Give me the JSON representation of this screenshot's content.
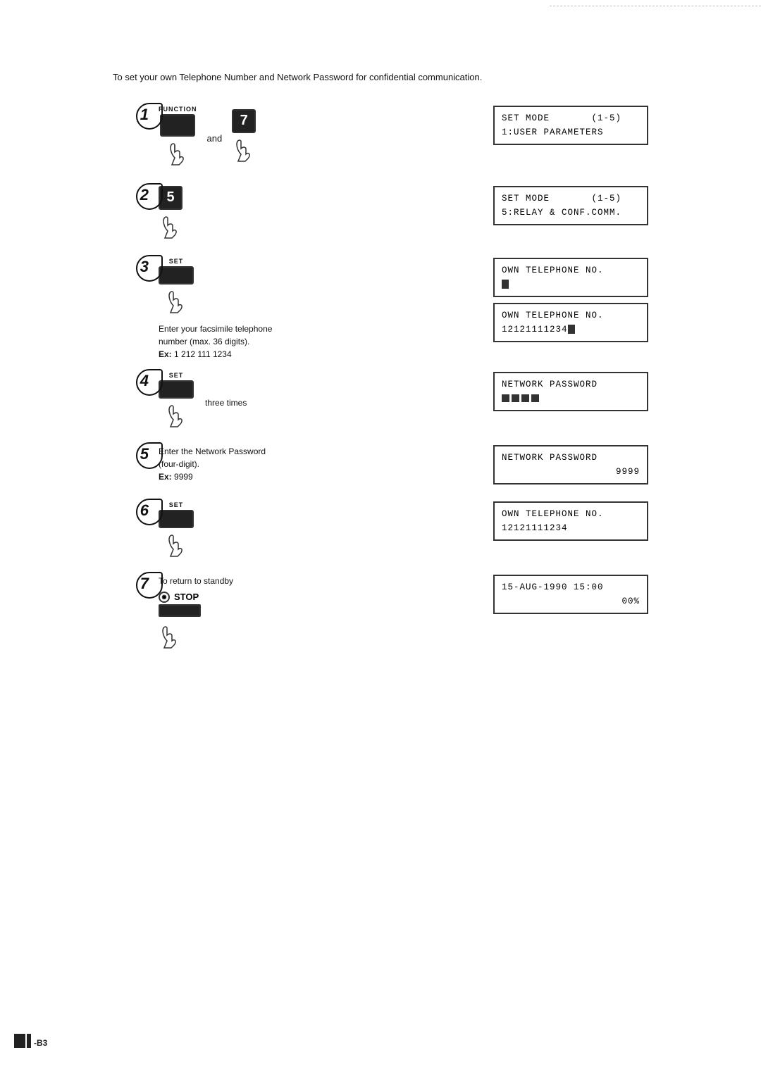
{
  "intro": {
    "text": "To set your own Telephone Number and Network Password for confidential communication."
  },
  "steps": [
    {
      "number": "1",
      "action_label": "FUNCTION + 7",
      "and_text": "and",
      "display": {
        "line1": "SET  MODE        (1-5)",
        "line2": "1:USER  PARAMETERS"
      }
    },
    {
      "number": "2",
      "action_label": "5",
      "display": {
        "line1": "SET  MODE        (1-5)",
        "line2": "5:RELAY & CONF.COMM."
      }
    },
    {
      "number": "3",
      "action_label": "SET",
      "description_line1": "Enter your facsimile telephone",
      "description_line2": "number (max. 36 digits).",
      "example": "Ex:  1 212 111 1234",
      "display1": {
        "line1": "OWN  TELEPHONE  NO.",
        "line2": "■"
      },
      "display2": {
        "line1": "OWN  TELEPHONE  NO.",
        "line2": "12121111234■"
      }
    },
    {
      "number": "4",
      "action_label": "SET",
      "three_times": "three times",
      "display": {
        "line1": "NETWORK  PASSWORD",
        "line2": "████"
      }
    },
    {
      "number": "5",
      "description_line1": "Enter the Network Password",
      "description_line2": "(four-digit).",
      "example": "Ex:  9999",
      "display": {
        "line1": "NETWORK  PASSWORD",
        "line2": "                9999"
      }
    },
    {
      "number": "6",
      "action_label": "SET",
      "display": {
        "line1": "OWN  TELEPHONE  NO.",
        "line2": "12121111234"
      }
    },
    {
      "number": "7",
      "description": "To return to standby",
      "stop_label": "STOP",
      "display": {
        "line1": "15-AUG-1990  15:00",
        "line2": "                 00%"
      }
    }
  ],
  "footer": {
    "page_num": "-B3"
  }
}
